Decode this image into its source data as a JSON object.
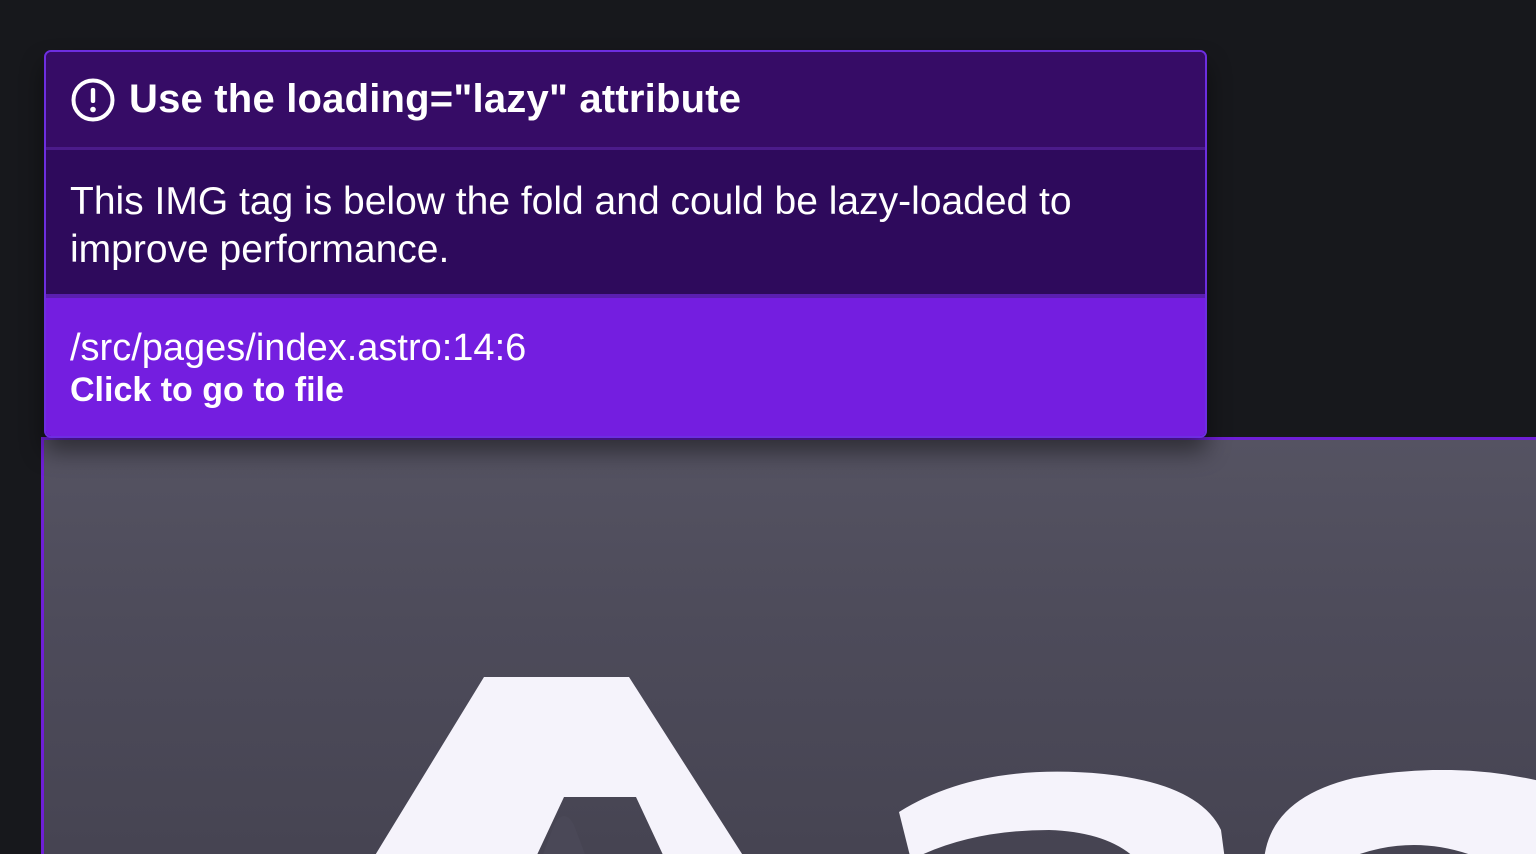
{
  "tooltip": {
    "icon": "exclamation-circle-icon",
    "title": "Use the loading=\"lazy\" attribute",
    "description": "This IMG tag is below the fold and could be lazy-loaded to improve performance.",
    "file_path": "/src/pages/index.astro:14:6",
    "action_label": "Click to go to file"
  },
  "colors": {
    "page_background": "#17181c",
    "header_background": "#360c66",
    "body_background": "#2e0a5c",
    "footer_background": "#741ee0",
    "border_accent": "#6d2ee0",
    "image_background": "#504e5d",
    "image_glyph": "#f5f3fb"
  }
}
